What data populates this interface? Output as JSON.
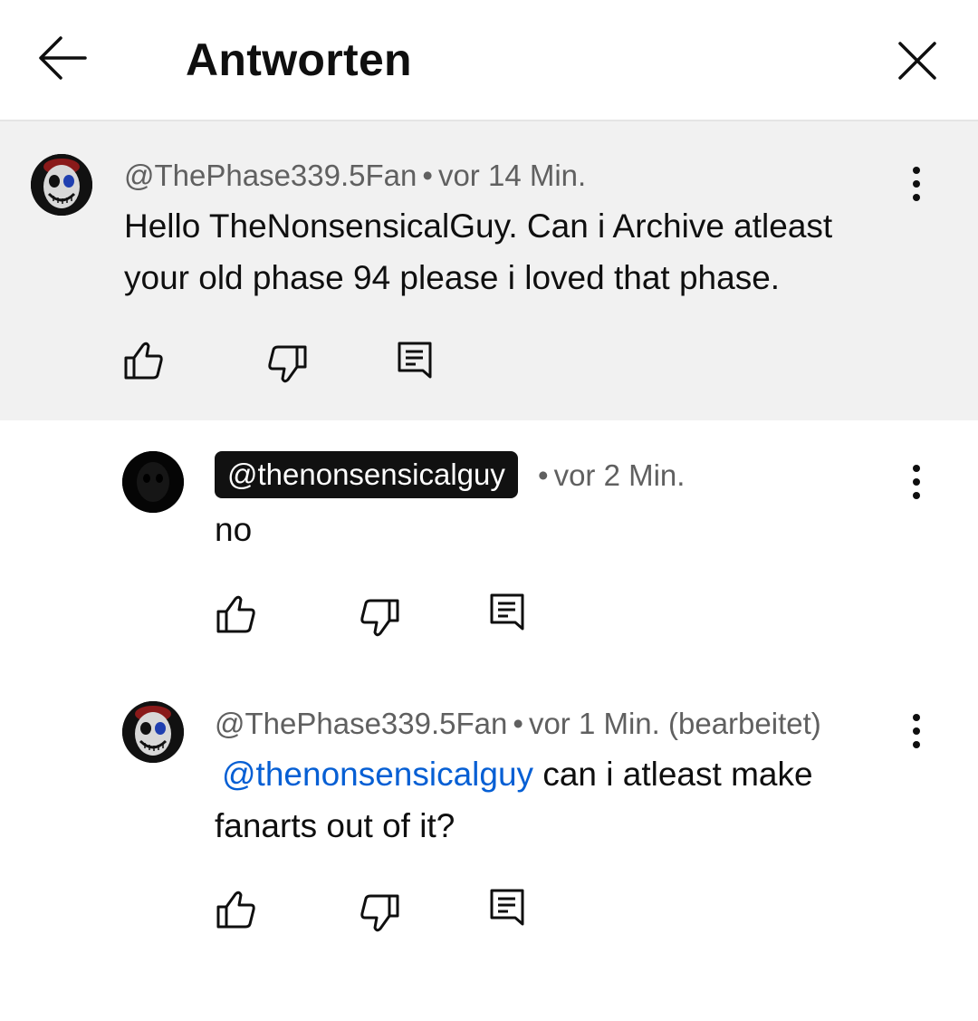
{
  "header": {
    "title": "Antworten",
    "back_icon": "arrow-left-icon",
    "close_icon": "close-icon"
  },
  "comments": [
    {
      "handle": "@ThePhase339.5Fan",
      "separator": "•",
      "time": "vor 14 Min.",
      "text": "Hello TheNonsensicalGuy. Can i Archive atleast your old phase 94 please i loved that phase.",
      "highlighted": true
    },
    {
      "handle": "@thenonsensicalguy",
      "separator": "•",
      "time": "vor 2 Min.",
      "text": "no",
      "is_channel_owner": true
    },
    {
      "handle": "@ThePhase339.5Fan",
      "separator": "•",
      "time": "vor 1 Min. (bearbeitet)",
      "mention": "@thenonsensicalguy",
      "text": "can i atleast make fanarts out of it?"
    }
  ],
  "icons": {
    "like": "thumbs-up-icon",
    "dislike": "thumbs-down-icon",
    "reply": "reply-comment-icon",
    "menu": "more-vert-icon"
  },
  "colors": {
    "highlight_bg": "#f1f1f1",
    "meta_text": "#606060",
    "mention_link": "#065fd4",
    "owner_chip_bg": "#111111"
  }
}
